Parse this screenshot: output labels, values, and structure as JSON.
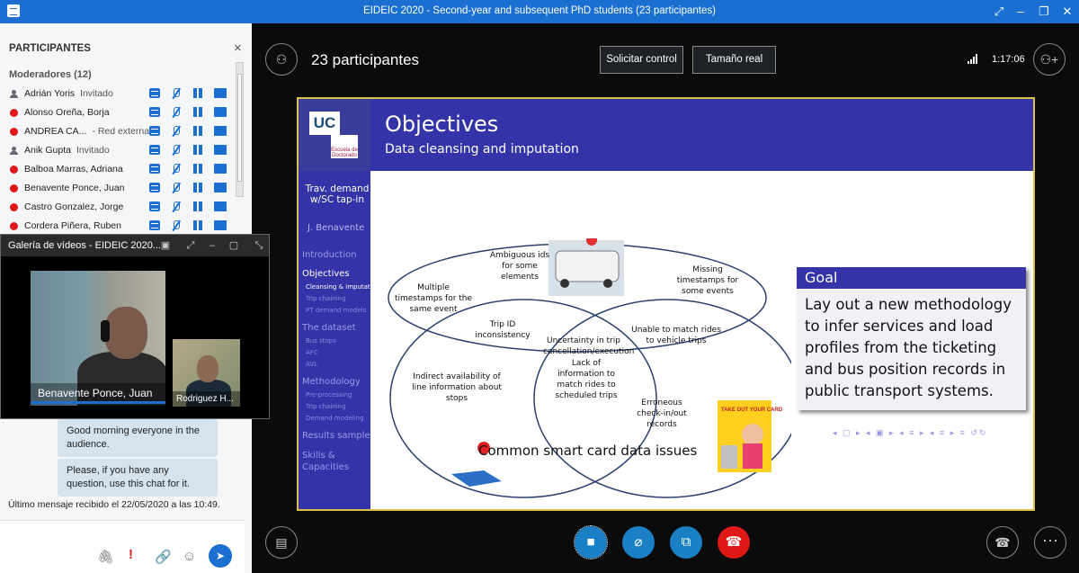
{
  "window": {
    "title": "EIDEIC 2020 - Second-year and subsequent PhD students (23 participantes)"
  },
  "sidebar": {
    "title": "PARTICIPANTES",
    "moderators_header": "Moderadores (12)",
    "participants": [
      {
        "name": "Adrián Yoris",
        "role": "Invitado",
        "status": "guest"
      },
      {
        "name": "Alonso Oreña, Borja",
        "role": "",
        "status": "busy"
      },
      {
        "name": "ANDREA CA...",
        "role": "- Red externa",
        "status": "busy"
      },
      {
        "name": "Anik Gupta",
        "role": "Invitado",
        "status": "guest"
      },
      {
        "name": "Balboa Marras, Adriana",
        "role": "",
        "status": "busy"
      },
      {
        "name": "Benavente Ponce, Juan",
        "role": "",
        "status": "busy"
      },
      {
        "name": "Castro Gonzalez, Jorge",
        "role": "",
        "status": "busy"
      },
      {
        "name": "Cordera Piñera, Ruben",
        "role": "",
        "status": "busy"
      }
    ],
    "chat": {
      "messages": [
        "Good morning everyone in the audience.",
        "Please, if you have any question, use this chat for it."
      ],
      "last_message": "Último mensaje recibido el 22/05/2020 a las 10:49."
    }
  },
  "gallery": {
    "title": "Galería de vídeos - EIDEIC 2020...",
    "videos": [
      {
        "name": "Benavente Ponce, Juan"
      },
      {
        "name": "Rodriguez H..."
      }
    ]
  },
  "toolbar": {
    "participants_count": "23 participantes",
    "request_control": "Solicitar control",
    "actual_size": "Tamaño real",
    "time": "1:17:06"
  },
  "slide": {
    "title": "Objectives",
    "subtitle": "Data cleansing and imputation",
    "nav": {
      "talk_title": "Trav. demand w/SC tap-in",
      "author": "J. Benavente",
      "sections": [
        {
          "label": "Introduction",
          "active": false
        },
        {
          "label": "Objectives",
          "active": true,
          "subs": [
            "Cleansing & imputat.",
            "Trip chaining",
            "PT demand models"
          ]
        },
        {
          "label": "The dataset",
          "active": false,
          "subs": [
            "Bus stops",
            "AFC",
            "AVL"
          ]
        },
        {
          "label": "Methodology",
          "active": false,
          "subs": [
            "Pre-processing",
            "Trip chaining",
            "Demand modeling"
          ]
        },
        {
          "label": "Results sample",
          "active": false
        },
        {
          "label": "Skills & Capacities",
          "active": false
        }
      ]
    },
    "venn": {
      "labels": [
        "Ambiguous ids for some elements",
        "Multiple timestamps for the same event",
        "Missing timestamps for some events",
        "Trip ID inconsistency",
        "Uncertainty in trip cancellation/execution",
        "Unable to match rides to vehicle trips",
        "Indirect availability of line information about stops",
        "Lack of information to match rides to scheduled trips",
        "Erroneous check-in/out records"
      ],
      "caption": "Common smart card data issues",
      "poster_text": "TAKE OUT YOUR CARD AND TAP."
    },
    "goal": {
      "header": "Goal",
      "body": "Lay out a new methodology to infer services and load profiles from the ticketing and bus position records in public transport systems."
    },
    "logo": {
      "uc": "UC",
      "doctorado": "Escuela de Doctorado"
    }
  }
}
